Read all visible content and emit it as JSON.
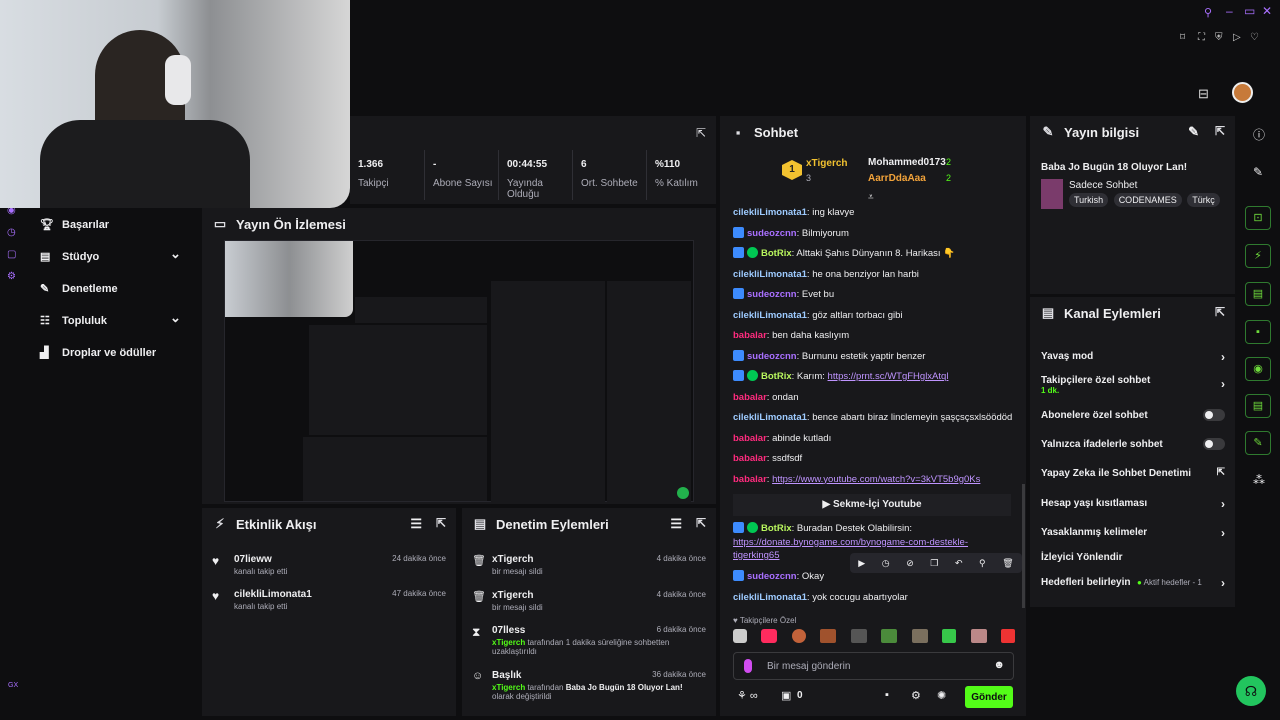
{
  "colors": {
    "bg": "#0e0e10",
    "panel": "#18181b",
    "accent": "#a970ff",
    "send": "#53fc18"
  },
  "sidebar": {
    "items": [
      {
        "icon": "trophy-icon",
        "label": "Başarılar"
      },
      {
        "icon": "studio-icon",
        "label": "Stüdyo",
        "chevron": "⌄"
      },
      {
        "icon": "wrench-icon",
        "label": "Denetleme"
      },
      {
        "icon": "community-icon",
        "label": "Topluluk",
        "chevron": "⌄"
      },
      {
        "icon": "drops-icon",
        "label": "Droplar ve ödüller"
      }
    ],
    "bottom_label": "GX"
  },
  "stats": [
    {
      "value": "1.366",
      "label": "Takipçi"
    },
    {
      "value": "-",
      "label": "Abone Sayısı"
    },
    {
      "value": "00:44:55",
      "label": "Yayında Olduğu"
    },
    {
      "value": "6",
      "label": "Ort. Sohbete"
    },
    {
      "value": "%110",
      "label": "% Katılım"
    }
  ],
  "preview": {
    "title": "Yayın Ön İzlemesi"
  },
  "activity": {
    "title": "Etkinlik Akışı",
    "items": [
      {
        "name": "07lieww",
        "desc": "kanalı takip etti",
        "time": "24 dakika önce"
      },
      {
        "name": "cilekliLimonata1",
        "desc": "kanalı takip etti",
        "time": "47 dakika önce"
      }
    ]
  },
  "moderation": {
    "title": "Denetim Eylemleri",
    "items": [
      {
        "icon": "trash-icon",
        "name": "xTigerch",
        "desc": "bir mesajı sildi",
        "time": "4 dakika önce"
      },
      {
        "icon": "trash-icon",
        "name": "xTigerch",
        "desc": "bir mesajı sildi",
        "time": "4 dakika önce"
      },
      {
        "icon": "hourglass-icon",
        "name": "07lless",
        "desc_user": "xTigerch",
        "desc": "tarafından 1 dakika süreliğine sohbetten uzaklaştırıldı",
        "time": "6 dakika önce"
      },
      {
        "icon": "title-icon",
        "name": "Başlık",
        "desc_user": "xTigerch",
        "desc_mid": "tarafından",
        "desc_bold": "Baba Jo Bugün 18 Oluyor Lan!",
        "desc": "olarak değiştirildi",
        "time": "36 dakika önce"
      }
    ]
  },
  "chat": {
    "title": "Sohbet",
    "leaderboard": [
      {
        "name": "xTigerch",
        "count": "3",
        "rank": "1"
      },
      {
        "name": "Mohammed0173",
        "count": "2"
      },
      {
        "name": "AarrDdaAaa",
        "count": "2"
      }
    ],
    "messages": [
      {
        "user": "cilekliLimonata1",
        "cls": "u1",
        "text": "ing klavye"
      },
      {
        "user": "sudeozcnn",
        "cls": "u2",
        "badge": "b",
        "text": "Bilmiyorum"
      },
      {
        "user": "BotRix",
        "cls": "u4",
        "badge": "bg",
        "text": "Alttaki Şahıs Dünyanın 8. Harikası 👇"
      },
      {
        "user": "cilekliLimonata1",
        "cls": "u1",
        "text": "he ona benziyor lan harbi"
      },
      {
        "user": "sudeozcnn",
        "cls": "u2",
        "badge": "b",
        "text": "Evet bu"
      },
      {
        "user": "cilekliLimonata1",
        "cls": "u1",
        "text": "göz altları torbacı gibi"
      },
      {
        "user": "babalar",
        "cls": "u3",
        "text": "ben daha kaslıyım"
      },
      {
        "user": "sudeozcnn",
        "cls": "u2",
        "badge": "b",
        "text": "Burnunu estetik yaptir benzer"
      },
      {
        "user": "BotRix",
        "cls": "u4",
        "badge": "bg",
        "text": "Karım: ",
        "link": "https://prnt.sc/WTgFHglxAtql"
      },
      {
        "user": "babalar",
        "cls": "u3",
        "text": "ondan"
      },
      {
        "user": "cilekliLimonata1",
        "cls": "u1",
        "text": "bence abartı biraz linclemeyin şaşçsçsxlsöödöd"
      },
      {
        "user": "babalar",
        "cls": "u3",
        "text": "abinde kutladı"
      },
      {
        "user": "babalar",
        "cls": "u3",
        "text": "ssdfsdf"
      },
      {
        "user": "babalar",
        "cls": "u3",
        "text": "",
        "link": "https://www.youtube.com/watch?v=3kVT5b9g0Ks"
      }
    ],
    "youtube_button": "Sekme-İçi Youtube",
    "botrix2": {
      "user": "BotRix",
      "text": "Buradan Destek Olabilirsin:",
      "link": "https://donate.bynogame.com/bynogame-com-destekle-tigerking65"
    },
    "okay": {
      "user": "sudeozcnn",
      "text": "Okay"
    },
    "last": {
      "user": "cilekliLimonata1",
      "text": "yok cocugu abartıyolar"
    },
    "followers_label": "Takipçilere Özel",
    "input_placeholder": "Bir mesaj gönderin",
    "points": "0",
    "send": "Gönder"
  },
  "stream_info": {
    "title": "Yayın bilgisi",
    "stream_title": "Baba Jo Bugün 18 Oluyor Lan!",
    "category": "Sadece Sohbet",
    "tags": [
      "Turkish",
      "CODENAMES",
      "Türkç"
    ]
  },
  "channel_actions": {
    "title": "Kanal Eylemleri",
    "items": [
      {
        "label": "Yavaş mod",
        "ctrl": "chevron"
      },
      {
        "label": "Takipçilere özel sohbet",
        "sub": "1 dk.",
        "ctrl": "chevron"
      },
      {
        "label": "Abonelere özel sohbet",
        "ctrl": "toggle"
      },
      {
        "label": "Yalnızca ifadelerle sohbet",
        "ctrl": "toggle"
      },
      {
        "label": "Yapay Zeka ile Sohbet Denetimi",
        "ctrl": "popout"
      },
      {
        "label": "Hesap yaşı kısıtlaması",
        "ctrl": "chevron"
      },
      {
        "label": "Yasaklanmış kelimeler",
        "ctrl": "chevron"
      },
      {
        "label": "İzleyici Yönlendir",
        "ctrl": "none"
      },
      {
        "label": "Hedefleri belirleyin",
        "extra": "Aktif hedefler - 1",
        "ctrl": "chevron"
      }
    ]
  }
}
